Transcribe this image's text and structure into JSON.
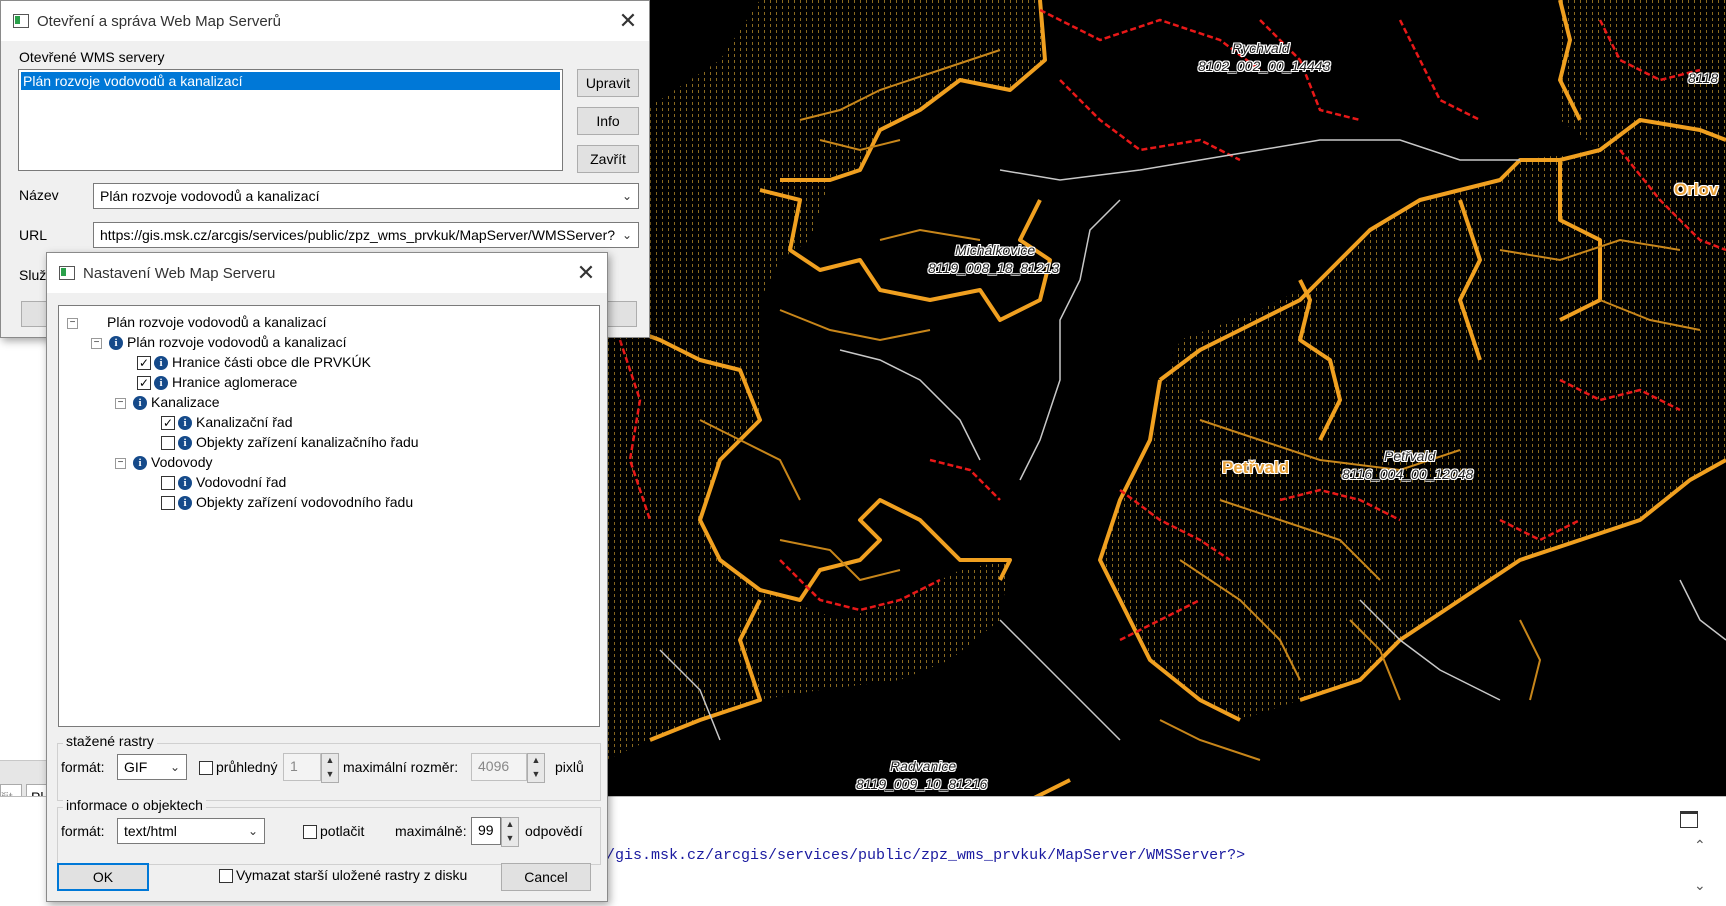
{
  "wms_manager": {
    "title": "Otevření a správa Web Map Serverů",
    "open_servers_label": "Otevřené WMS servery",
    "servers": [
      "Plán rozvoje vodovodů a kanalizací"
    ],
    "edit_button": "Upravit",
    "info_button": "Info",
    "close_button": "Zavřít",
    "name_label": "Název",
    "name_value": "Plán rozvoje vodovodů a kanalizací",
    "url_label": "URL",
    "url_value": "https://gis.msk.cz/arcgis/services/public/zpz_wms_prvkuk/MapServer/WMSServer?",
    "service_label_partial": "Služ",
    "partial_button_right": "o"
  },
  "wms_settings": {
    "title": "Nastavení Web Map Serveru",
    "tree": {
      "root": "Plán rozvoje vodovodů a kanalizací",
      "service": "Plán rozvoje vodovodů a kanalizací",
      "layers": [
        {
          "label": "Hranice části obce dle PRVKÚK",
          "checked": true
        },
        {
          "label": "Hranice aglomerace",
          "checked": true
        }
      ],
      "group_kanalizace": "Kanalizace",
      "kanalizace_layers": [
        {
          "label": "Kanalizační řad",
          "checked": true
        },
        {
          "label": "Objekty zařízení kanalizačního řadu",
          "checked": false
        }
      ],
      "group_vodovody": "Vodovody",
      "vodovody_layers": [
        {
          "label": "Vodovodní řad",
          "checked": false
        },
        {
          "label": "Objekty zařízení vodovodního řadu",
          "checked": false
        }
      ]
    },
    "rasters": {
      "group_label": "stažené rastry",
      "format_label": "formát:",
      "format_value": "GIF",
      "transparent_label": "průhledný",
      "transparent_checked": false,
      "transparent_count": "1",
      "max_size_label": "maximální rozměr:",
      "max_size_value": "4096",
      "unit_label": "pixlů"
    },
    "feature_info": {
      "group_label": "informace o objektech",
      "format_label": "formát:",
      "format_value": "text/html",
      "suppress_label": "potlačit",
      "suppress_checked": false,
      "max_label": "maximálně:",
      "max_value": "99",
      "responses_label": "odpovědí"
    },
    "delete_old_label": "Vymazat starší uložené rastry z disku",
    "delete_old_checked": false,
    "ok_button": "OK",
    "cancel_button": "Cancel"
  },
  "map": {
    "labels": [
      {
        "text": "Rychvald",
        "kind": "area"
      },
      {
        "text": "8102_002_00_14443",
        "kind": "area"
      },
      {
        "text": "Michálkovice",
        "kind": "area"
      },
      {
        "text": "8119_008_18_81213",
        "kind": "area"
      },
      {
        "text": "Petřvald",
        "kind": "area"
      },
      {
        "text": "8116_004_00_12048",
        "kind": "area"
      },
      {
        "text": "Radvanice",
        "kind": "area"
      },
      {
        "text": "8119_009_10_81216",
        "kind": "area"
      },
      {
        "text": "8118",
        "kind": "area"
      }
    ],
    "town_labels": [
      "Petřvald",
      "Orlov"
    ],
    "colors": {
      "background": "#000000",
      "boundary": "#f0a020",
      "sewer": "#e81818",
      "municipal_line": "#c8c8c8"
    }
  },
  "console": {
    "url_text": "/gis.msk.cz/arcgis/services/public/zpz_wms_prvkuk/MapServer/WMSServer?>"
  },
  "left_strip": {
    "tab1": "řit",
    "tab2": "Pl"
  }
}
